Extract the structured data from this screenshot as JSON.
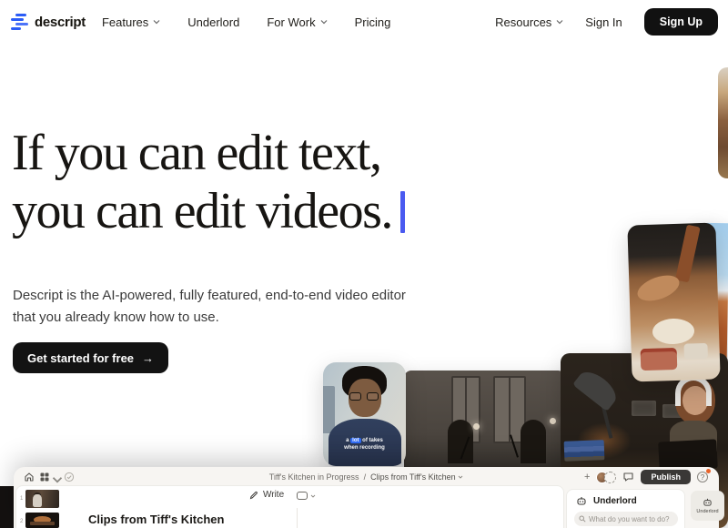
{
  "header": {
    "brand": "descript",
    "nav_items": [
      {
        "label": "Features"
      },
      {
        "label": "Underlord"
      },
      {
        "label": "For Work"
      },
      {
        "label": "Pricing"
      }
    ],
    "resources_label": "Resources",
    "sign_in_label": "Sign In",
    "sign_up_label": "Sign Up"
  },
  "hero": {
    "headline_line1": "If you can edit text,",
    "headline_line2": "you can edit videos.",
    "subtitle_line1": "Descript is the AI-powered, fully featured, end-to-end video editor",
    "subtitle_line2": "that you already know how to use.",
    "cta_label": "Get started for free",
    "cta_arrow": "→"
  },
  "collage": {
    "tshirt_caption": {
      "word1": "a",
      "highlight": "lot",
      "rest": "of takes",
      "line2": "when recording"
    }
  },
  "app": {
    "breadcrumb": {
      "project": "Tiff's Kitchen in Progress",
      "separator": "/",
      "current": "Clips from Tiff's Kitchen"
    },
    "toolbar": {
      "publish_label": "Publish",
      "plus_glyph": "+",
      "help_glyph": "?"
    },
    "editor": {
      "clip1_index": "1",
      "clip2_index": "2",
      "title": "Clips from Tiff's Kitchen",
      "write_label": "Write"
    },
    "underlord": {
      "panel_title": "Underlord",
      "input_placeholder": "What do you want to do?",
      "rail_label": "Underlord"
    }
  },
  "colors": {
    "accent_blue": "#2b5cf6",
    "cursor_blue": "#4a5af0",
    "button_black": "#131313",
    "caption_highlight_blue": "#2f6bf5",
    "notification_orange": "#e8632a"
  }
}
